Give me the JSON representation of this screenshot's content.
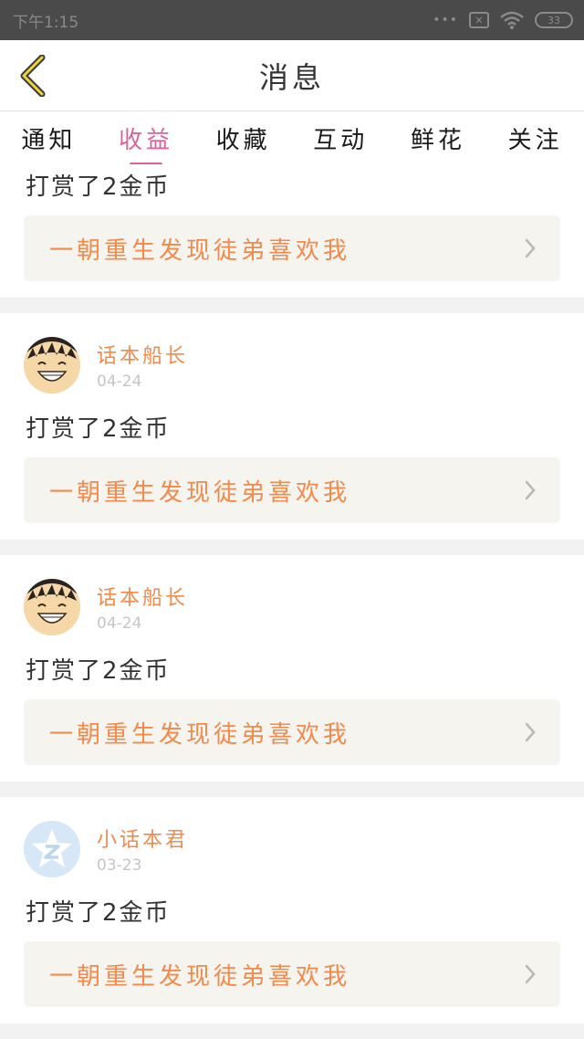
{
  "status_bar": {
    "time": "下午1:15",
    "dots": "•••",
    "sim": "✕",
    "battery": "33"
  },
  "header": {
    "title": "消息",
    "back_icon": "chevron-left-icon"
  },
  "tabs": [
    {
      "label": "通知",
      "active": false
    },
    {
      "label": "收益",
      "active": true
    },
    {
      "label": "收藏",
      "active": false
    },
    {
      "label": "互动",
      "active": false
    },
    {
      "label": "鲜花",
      "active": false
    },
    {
      "label": "关注",
      "active": false
    }
  ],
  "feed": {
    "partial": {
      "message": "打赏了2金币",
      "link": "一朝重生发现徒弟喜欢我"
    },
    "items": [
      {
        "user": "话本船长",
        "date": "04-24",
        "message": "打赏了2金币",
        "link": "一朝重生发现徒弟喜欢我",
        "avatar": "luffy-avatar"
      },
      {
        "user": "话本船长",
        "date": "04-24",
        "message": "打赏了2金币",
        "link": "一朝重生发现徒弟喜欢我",
        "avatar": "luffy-avatar"
      },
      {
        "user": "小话本君",
        "date": "03-23",
        "message": "打赏了2金币",
        "link": "一朝重生发现徒弟喜欢我",
        "avatar": "z-star-avatar"
      }
    ]
  },
  "colors": {
    "accent": "#e0609a",
    "link": "#f28a4b",
    "date": "#c6c6c6"
  }
}
